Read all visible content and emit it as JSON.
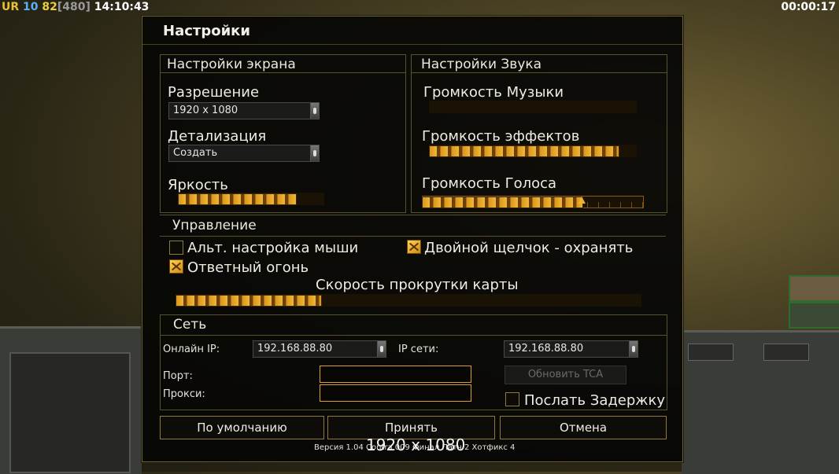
{
  "hud": {
    "ur": "UR",
    "ping": "10",
    "fps": "82",
    "fps_cap": "[480]",
    "clock": "14:10:43",
    "timer": "00:00:17"
  },
  "dialog": {
    "title": "Настройки",
    "display": {
      "title": "Настройки экрана",
      "resolution_label": "Разрешение",
      "resolution_value": "1920 x 1080",
      "detail_label": "Детализация",
      "detail_value": "Создать",
      "brightness_label": "Яркость",
      "brightness_level": 0.8
    },
    "sound": {
      "title": "Настройки Звука",
      "music_label": "Громкость Музыки",
      "music_level": 0.0,
      "effects_label": "Громкость эффектов",
      "effects_level": 0.91,
      "voice_label": "Громкость Голоса",
      "voice_level": 0.72
    },
    "controls": {
      "title": "Управление",
      "alt_mouse_label": "Альт. настройка мыши",
      "alt_mouse_checked": false,
      "double_click_label": "Двойной щелчок - охранять",
      "double_click_checked": true,
      "return_fire_label": "Ответный огонь",
      "return_fire_checked": true,
      "scroll_speed_label": "Скорость прокрутки карты",
      "scroll_speed_level": 0.31
    },
    "network": {
      "title": "Сеть",
      "online_ip_label": "Онлайн IP:",
      "online_ip_value": "192.168.88.80",
      "lan_ip_label": "IP сети:",
      "lan_ip_value": "192.168.88.80",
      "port_label": "Порт:",
      "proxy_label": "Прокси:",
      "update_tca_label": "Обновить TCA",
      "send_delay_label": "Послать Задержку",
      "send_delay_checked": false
    },
    "buttons": {
      "defaults": "По умолчанию",
      "accept": "Принять",
      "cancel": "Отмена"
    },
    "version": "Версия 1.04 Contra 009 Финал Патч 2 Хотфикс 4",
    "overlay_text": "1920 x 1080"
  },
  "colors": {
    "frame": "#6e6230",
    "slider_fill": "#f0b838",
    "input_border": "#d8a030"
  }
}
